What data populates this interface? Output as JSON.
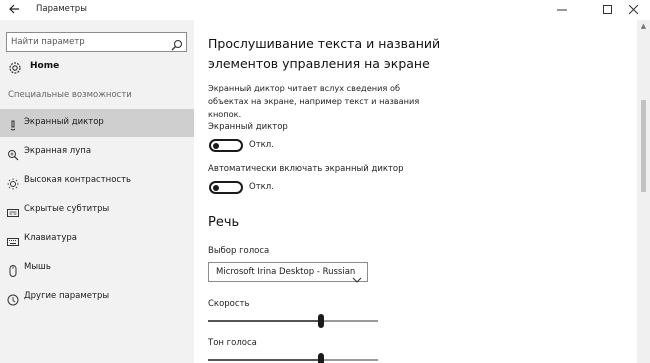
{
  "window": {
    "title": "Параметры",
    "back_icon": "arrow-left-icon",
    "controls": {
      "minimize": "—",
      "maximize": "☐",
      "close": "✕"
    }
  },
  "sidebar": {
    "search": {
      "placeholder": "Найти параметр",
      "value": "",
      "icon": "search-icon"
    },
    "home": {
      "label": "Home",
      "icon": "gear-icon"
    },
    "section_label": "Специальные возможности",
    "items": [
      {
        "label": "Экранный диктор",
        "icon": "narrator-icon",
        "selected": true
      },
      {
        "label": "Экранная лупа",
        "icon": "magnifier-icon",
        "selected": false
      },
      {
        "label": "Высокая контрастность",
        "icon": "contrast-icon",
        "selected": false
      },
      {
        "label": "Скрытые субтитры",
        "icon": "captions-icon",
        "selected": false
      },
      {
        "label": "Клавиатура",
        "icon": "keyboard-icon",
        "selected": false
      },
      {
        "label": "Мышь",
        "icon": "mouse-icon",
        "selected": false
      },
      {
        "label": "Другие параметры",
        "icon": "other-options-icon",
        "selected": false
      }
    ]
  },
  "main": {
    "title": "Прослушивание текста и названий элементов управления на экране",
    "description": "Экранный диктор читает вслух сведения об объектах на экране, например текст и названия кнопок.",
    "narrator": {
      "label": "Экранный диктор",
      "state_label": "Откл.",
      "on": false
    },
    "auto_start": {
      "label": "Автоматически включать экранный диктор",
      "state_label": "Откл.",
      "on": false
    },
    "speech": {
      "heading": "Речь",
      "voice_label": "Выбор голоса",
      "voice_value": "Microsoft Irina Desktop - Russian",
      "speed_label": "Скорость",
      "speed_fraction": 0.5,
      "pitch_label": "Тон голоса",
      "pitch_fraction": 0.5
    }
  },
  "colors": {
    "sidebar_bg": "#f2f2f2",
    "selected_bg": "#cfcfcf",
    "content_bg": "#ffffff",
    "text": "#1a1a1a"
  }
}
